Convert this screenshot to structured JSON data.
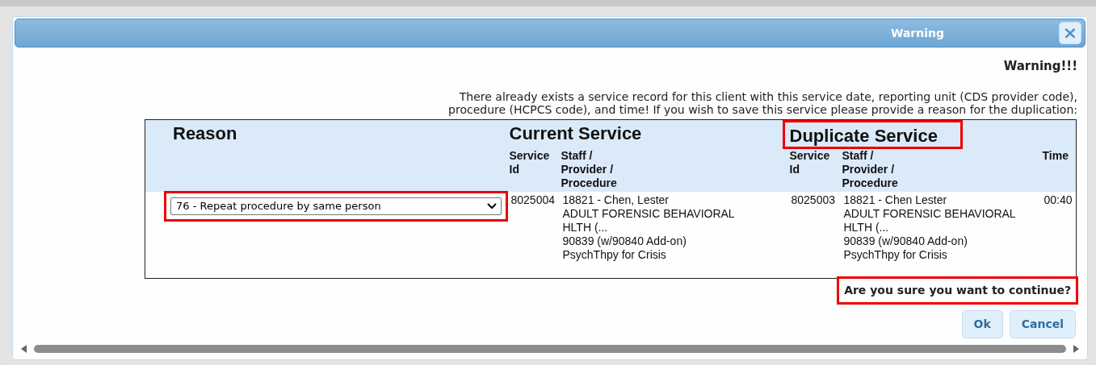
{
  "window": {
    "title": "Warning",
    "close_label": "×"
  },
  "heading": "Warning!!!",
  "message_lines": [
    "There already exists a service record for this client with this service date, reporting unit (CDS provider code),",
    "procedure (HCPCS code), and time! If you wish to save this service please provide a reason for the duplication:"
  ],
  "table": {
    "groups": [
      {
        "label": "Reason",
        "highlighted": false
      },
      {
        "label": "Current Service",
        "highlighted": false
      },
      {
        "label": "Duplicate Service",
        "highlighted": true
      }
    ],
    "columns": [
      "Service Id",
      "Staff / Provider / Procedure",
      "Service Id",
      "Staff / Provider / Procedure",
      "Time"
    ],
    "reason": {
      "value": "76 - Repeat procedure by same person",
      "highlighted": true
    },
    "cells": [
      {
        "lines": [
          "8025004"
        ]
      },
      {
        "lines": [
          "18821 - Chen, Lester",
          "ADULT FORENSIC BEHAVIORAL",
          "HLTH (...",
          "90839 (w/90840 Add-on)",
          "PsychThpy for Crisis"
        ]
      },
      {
        "lines": [
          "8025003"
        ]
      },
      {
        "lines": [
          "18821 - Chen Lester",
          "ADULT FORENSIC BEHAVIORAL",
          "HLTH (...",
          "90839 (w/90840 Add-on)",
          "PsychThpy for Crisis"
        ]
      },
      {
        "lines": [
          "00:40"
        ]
      }
    ]
  },
  "question": {
    "text": "Are you sure you want to continue?",
    "highlighted": true
  },
  "buttons": [
    "Ok",
    "Cancel"
  ]
}
